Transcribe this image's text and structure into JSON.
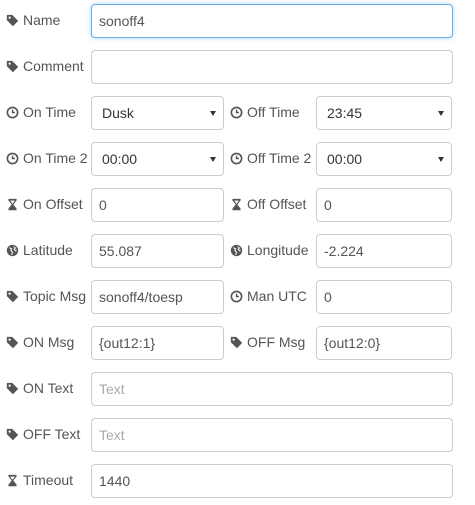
{
  "fields": {
    "name": {
      "label": "Name",
      "value": "sonoff4"
    },
    "comment": {
      "label": "Comment",
      "value": ""
    },
    "on_time": {
      "label": "On Time",
      "value": "Dusk"
    },
    "off_time": {
      "label": "Off Time",
      "value": "23:45"
    },
    "on_time2": {
      "label": "On Time 2",
      "value": "00:00"
    },
    "off_time2": {
      "label": "Off Time 2",
      "value": "00:00"
    },
    "on_offset": {
      "label": "On Offset",
      "value": "0"
    },
    "off_offset": {
      "label": "Off Offset",
      "value": "0"
    },
    "latitude": {
      "label": "Latitude",
      "value": "55.087"
    },
    "longitude": {
      "label": "Longitude",
      "value": "-2.224"
    },
    "topic_msg": {
      "label": "Topic Msg",
      "value": "sonoff4/toesp"
    },
    "man_utc": {
      "label": "Man UTC",
      "value": "0"
    },
    "on_msg": {
      "label": "ON Msg",
      "value": "{out12:1}"
    },
    "off_msg": {
      "label": "OFF Msg",
      "value": "{out12:0}"
    },
    "on_text": {
      "label": "ON Text",
      "value": "",
      "placeholder": "Text"
    },
    "off_text": {
      "label": "OFF Text",
      "value": "",
      "placeholder": "Text"
    },
    "timeout": {
      "label": "Timeout",
      "value": "1440"
    }
  },
  "icons": {
    "name": "tag-icon",
    "comment": "tag-icon",
    "on_time": "clock-icon",
    "off_time": "clock-icon",
    "on_time2": "clock-icon",
    "off_time2": "clock-icon",
    "on_offset": "hourglass-icon",
    "off_offset": "hourglass-icon",
    "latitude": "globe-icon",
    "longitude": "globe-icon",
    "topic_msg": "tag-icon",
    "man_utc": "clock-icon",
    "on_msg": "tag-icon",
    "off_msg": "tag-icon",
    "on_text": "tag-icon",
    "off_text": "tag-icon",
    "timeout": "hourglass-icon"
  },
  "colors": {
    "focus_border": "#66afe9",
    "border": "#cccccc",
    "label": "#555555"
  }
}
